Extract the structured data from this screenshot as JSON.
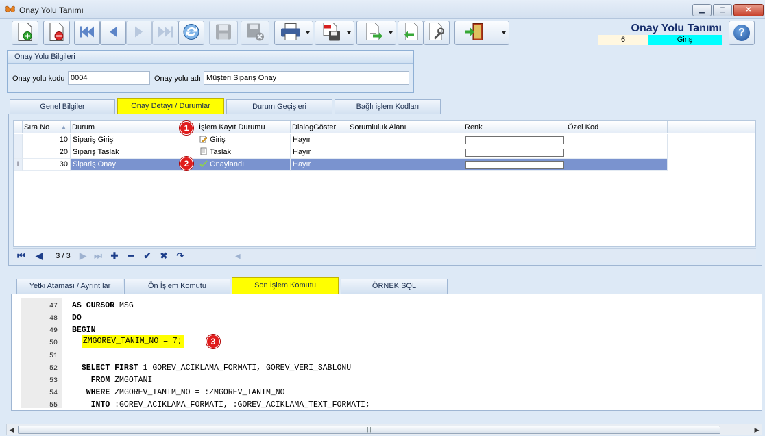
{
  "window": {
    "title": "Onay Yolu Tanımı",
    "icon": "butterfly-icon"
  },
  "header": {
    "title": "Onay Yolu Tanımı",
    "record_no": "6",
    "status": "Giriş",
    "status_color": "#00ffff"
  },
  "toolbar": {
    "buttons": [
      "new-record-icon",
      "delete-record-icon",
      "first-record-icon",
      "prev-record-icon",
      "next-record-icon",
      "last-record-icon",
      "refresh-icon",
      "save-icon",
      "cancel-save-icon",
      "print-icon",
      "pdf-export-icon",
      "export-icon",
      "import-icon",
      "tools-icon",
      "exit-icon",
      "help-icon"
    ]
  },
  "info_group": {
    "title": "Onay Yolu Bilgileri",
    "code_label": "Onay yolu kodu",
    "code_value": "0004",
    "name_label": "Onay yolu adı",
    "name_value": "Müşteri Sipariş Onay"
  },
  "upper_tabs": [
    "Genel Bilgiler",
    "Onay Detayı / Durumlar",
    "Durum Geçişleri",
    "Bağlı işlem Kodları"
  ],
  "grid": {
    "columns": [
      "Sıra No",
      "Durum",
      "İşlem Kayıt Durumu",
      "DialogGöster",
      "Sorumluluk Alanı",
      "Renk",
      "Özel Kod"
    ],
    "rows": [
      {
        "sira": "10",
        "durum": "Sipariş Girişi",
        "islem": "Giriş",
        "islem_icon": "edit-icon",
        "dialog": "Hayır",
        "sorumluluk": "",
        "ozel": ""
      },
      {
        "sira": "20",
        "durum": "Sipariş Taslak",
        "islem": "Taslak",
        "islem_icon": "document-icon",
        "dialog": "Hayır",
        "sorumluluk": "",
        "ozel": ""
      },
      {
        "sira": "30",
        "durum": "Sipariş Onay",
        "islem": "Onaylandı",
        "islem_icon": "checkmark-icon",
        "dialog": "Hayır",
        "sorumluluk": "",
        "ozel": ""
      }
    ],
    "selected_row": 2,
    "selection_color": "#7a93cf"
  },
  "navigator": {
    "count": "3 / 3"
  },
  "callouts": [
    "1",
    "2",
    "3"
  ],
  "lower_tabs": [
    "Yetki Ataması / Ayrıntılar",
    "Ön İşlem Komutu",
    "Son İşlem Komutu",
    "ÖRNEK SQL"
  ],
  "code_lines": [
    {
      "n": "47",
      "kw": "AS CURSOR",
      "rest": " MSG",
      "indent": ""
    },
    {
      "n": "48",
      "kw": "DO",
      "rest": "",
      "indent": ""
    },
    {
      "n": "49",
      "kw": "BEGIN",
      "rest": "",
      "indent": ""
    },
    {
      "n": "50",
      "kw": "",
      "rest": "ZMGOREV_TANIM_NO = 7;",
      "indent": "  "
    },
    {
      "n": "51",
      "kw": "",
      "rest": "",
      "indent": ""
    },
    {
      "n": "52",
      "kw": "SELECT FIRST",
      "rest": " 1 GOREV_ACIKLAMA_FORMATI, GOREV_VERI_SABLONU",
      "indent": "  "
    },
    {
      "n": "53",
      "kw": "FROM",
      "rest": " ZMGOTANI",
      "indent": "    "
    },
    {
      "n": "54",
      "kw": "WHERE",
      "rest": " ZMGOREV_TANIM_NO = :ZMGOREV_TANIM_NO",
      "indent": "   "
    },
    {
      "n": "55",
      "kw": "INTO",
      "rest": " :GOREV_ACIKLAMA_FORMATI, :GOREV_ACIKLAMA_TEXT_FORMATI;",
      "indent": "    "
    }
  ]
}
